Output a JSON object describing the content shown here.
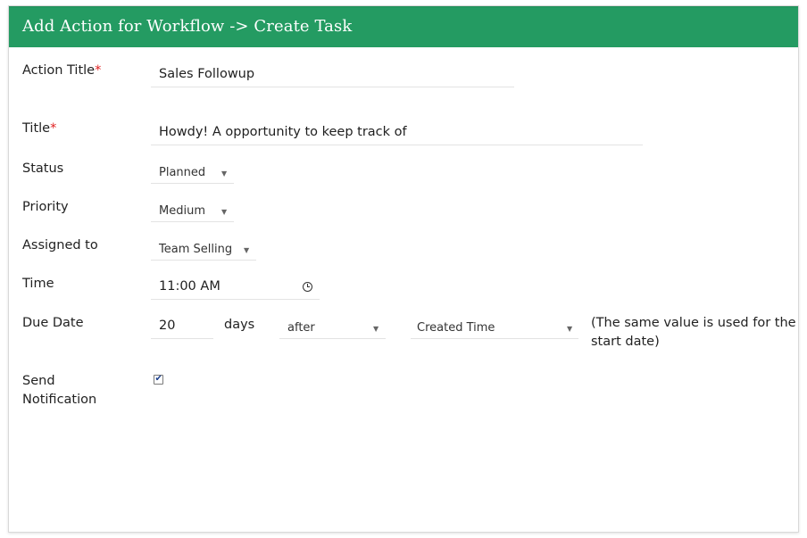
{
  "header": {
    "title": "Add Action for Workflow -> Create Task",
    "color": "#249b62"
  },
  "form": {
    "action_title": {
      "label": "Action Title",
      "required_mark": "*",
      "value": "Sales Followup"
    },
    "title": {
      "label": "Title",
      "required_mark": "*",
      "value": "Howdy! A opportunity to keep track of"
    },
    "status": {
      "label": "Status",
      "selected": "Planned"
    },
    "priority": {
      "label": "Priority",
      "selected": "Medium"
    },
    "assigned_to": {
      "label": "Assigned to",
      "selected": "Team Selling"
    },
    "time": {
      "label": "Time",
      "value": "11:00 AM",
      "icon": "clock-icon"
    },
    "due_date": {
      "label": "Due Date",
      "value": "20",
      "unit": "days",
      "direction": "after",
      "reference": "Created Time",
      "note_line1": "(The same value is used for the",
      "note_line2": "start date)"
    },
    "send_notification": {
      "label_line1": "Send",
      "label_line2": "Notification",
      "checked": true
    }
  },
  "colors": {
    "required": "#e02020",
    "header_bg": "#249b62"
  }
}
